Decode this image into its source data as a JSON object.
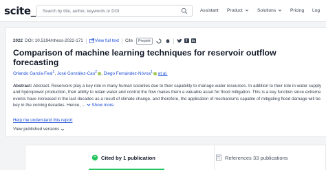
{
  "header": {
    "logo": "scite_",
    "search_placeholder": "Search by title, author, keywords or DOI",
    "nav": {
      "assistant": "Assistant",
      "product": "Product",
      "solutions": "Solutions",
      "pricing": "Pricing",
      "login": "Log"
    }
  },
  "paper": {
    "year": "2022",
    "doi": "DOI: 10.5194/nhess-2022-171",
    "view_full_text": "View full text",
    "cite": "Cite",
    "badge": "Preprint",
    "title": "Comparison of machine learning techniques for reservoir outflow forecasting",
    "authors": [
      "Orlando García-Feal",
      "José González-Cao",
      "Diego Fernández-Nóvoa"
    ],
    "author_sup": "1",
    "author_sup_2": "2",
    "et_al": "et al.",
    "abstract_label": "Abstract:",
    "abstract_text": "Abstract. Reservoirs play a key role in many human societies due to their capability to manage water resources. In addition to their role in water supply and hydropower production, their ability to retain water and control the flow makes them a valuable asset for flood mitigation. This is a key function since extreme events have increased in the last decades as a result of climate change, and therefore, the application of mechanisms capable of mitigating flood damage will be key in the coming decades. Hence, ...",
    "show_more": "Show more",
    "help_link": "Help me understand this report",
    "versions": "View published versions"
  },
  "tabs": {
    "cited": "Cited by 1 publication",
    "references": "References 33 publications"
  },
  "colors": {
    "link": "#1d4ed8",
    "active_tab": "#22c55e",
    "orcid": "#a3c853"
  }
}
